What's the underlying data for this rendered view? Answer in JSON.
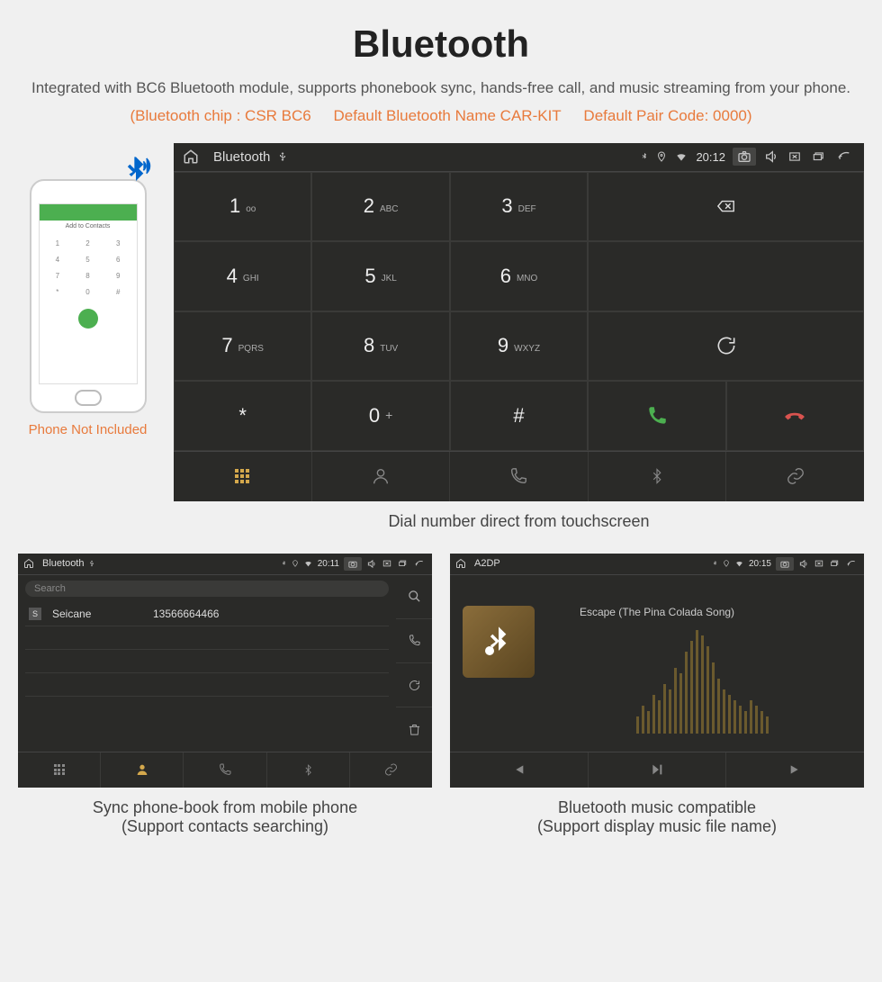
{
  "header": {
    "title": "Bluetooth",
    "desc": "Integrated with BC6 Bluetooth module, supports phonebook sync, hands-free call, and music streaming from your phone.",
    "spec_chip": "(Bluetooth chip : CSR BC6",
    "spec_name": "Default Bluetooth Name CAR-KIT",
    "spec_code": "Default Pair Code: 0000)"
  },
  "phone": {
    "caption": "Phone Not Included",
    "add_contacts": "Add to Contacts",
    "keys": [
      "1",
      "2",
      "3",
      "4",
      "5",
      "6",
      "7",
      "8",
      "9",
      "*",
      "0",
      "#"
    ]
  },
  "main_radio": {
    "status": {
      "title": "Bluetooth",
      "time": "20:12"
    },
    "keypad": [
      {
        "num": "1",
        "sub": "oo"
      },
      {
        "num": "2",
        "sub": "ABC"
      },
      {
        "num": "3",
        "sub": "DEF"
      },
      {
        "num": "4",
        "sub": "GHI"
      },
      {
        "num": "5",
        "sub": "JKL"
      },
      {
        "num": "6",
        "sub": "MNO"
      },
      {
        "num": "7",
        "sub": "PQRS"
      },
      {
        "num": "8",
        "sub": "TUV"
      },
      {
        "num": "9",
        "sub": "WXYZ"
      },
      {
        "num": "*",
        "sub": ""
      },
      {
        "num": "0",
        "sub": "+"
      },
      {
        "num": "#",
        "sub": ""
      }
    ],
    "caption": "Dial number direct from touchscreen"
  },
  "contacts_radio": {
    "status": {
      "title": "Bluetooth",
      "time": "20:11"
    },
    "search_placeholder": "Search",
    "contact": {
      "badge": "S",
      "name": "Seicane",
      "number": "13566664466"
    },
    "caption_line1": "Sync phone-book from mobile phone",
    "caption_line2": "(Support contacts searching)"
  },
  "music_radio": {
    "status": {
      "title": "A2DP",
      "time": "20:15"
    },
    "track": "Escape (The Pina Colada Song)",
    "caption_line1": "Bluetooth music compatible",
    "caption_line2": "(Support display music file name)"
  }
}
